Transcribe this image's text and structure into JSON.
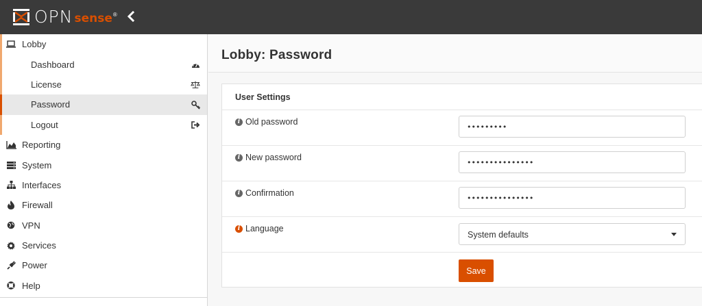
{
  "brand": {
    "name_primary": "OPN",
    "name_secondary": "sense",
    "reg_mark": "®",
    "accent_color": "#d94f00"
  },
  "topbar": {
    "collapse_icon": "chevron-left-icon",
    "collapse_glyph": "‹"
  },
  "sidebar": {
    "items": [
      {
        "label": "Lobby",
        "icon": "laptop-icon",
        "expanded": true,
        "children": [
          {
            "label": "Dashboard",
            "icon": "dashboard-icon"
          },
          {
            "label": "License",
            "icon": "balance-scale-icon"
          },
          {
            "label": "Password",
            "icon": "key-icon",
            "active": true
          },
          {
            "label": "Logout",
            "icon": "sign-out-icon"
          }
        ]
      },
      {
        "label": "Reporting",
        "icon": "area-chart-icon"
      },
      {
        "label": "System",
        "icon": "server-icon"
      },
      {
        "label": "Interfaces",
        "icon": "sitemap-icon"
      },
      {
        "label": "Firewall",
        "icon": "fire-icon"
      },
      {
        "label": "VPN",
        "icon": "globe-icon"
      },
      {
        "label": "Services",
        "icon": "cog-icon"
      },
      {
        "label": "Power",
        "icon": "plug-icon"
      },
      {
        "label": "Help",
        "icon": "life-ring-icon"
      }
    ]
  },
  "page": {
    "title": "Lobby: Password"
  },
  "form": {
    "section_title": "User Settings",
    "fields": [
      {
        "label": "Old password",
        "value": "•••••••••"
      },
      {
        "label": "New password",
        "value": "•••••••••••••••"
      },
      {
        "label": "Confirmation",
        "value": "•••••••••••••••"
      }
    ],
    "language": {
      "label": "Language",
      "selected": "System defaults"
    },
    "save_label": "Save"
  }
}
